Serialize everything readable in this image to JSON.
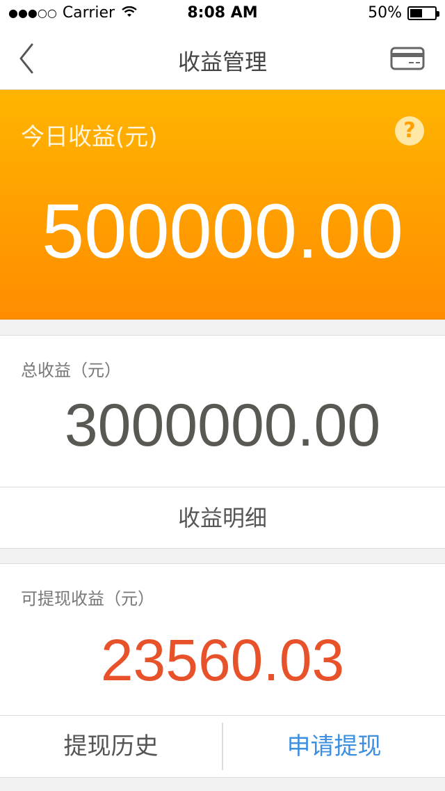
{
  "status_bar": {
    "signal": "●●●○○",
    "carrier": "Carrier",
    "time": "8:08 AM",
    "battery_text": "50%",
    "battery_level": 0.5
  },
  "nav": {
    "title": "收益管理",
    "back_icon": "chevron-left-icon",
    "card_icon": "credit-card-icon"
  },
  "today": {
    "label": "今日收益(元)",
    "help_symbol": "?",
    "amount": "500000.00"
  },
  "total": {
    "label": "总收益（元）",
    "amount": "3000000.00",
    "detail_link": "收益明细"
  },
  "withdraw": {
    "label": "可提现收益（元）",
    "amount": "23560.03",
    "history_button": "提现历史",
    "apply_button": "申请提现"
  },
  "colors": {
    "accent_orange": "#ff9f00",
    "amount_red": "#e8522b",
    "link_blue": "#3d8fe0"
  }
}
